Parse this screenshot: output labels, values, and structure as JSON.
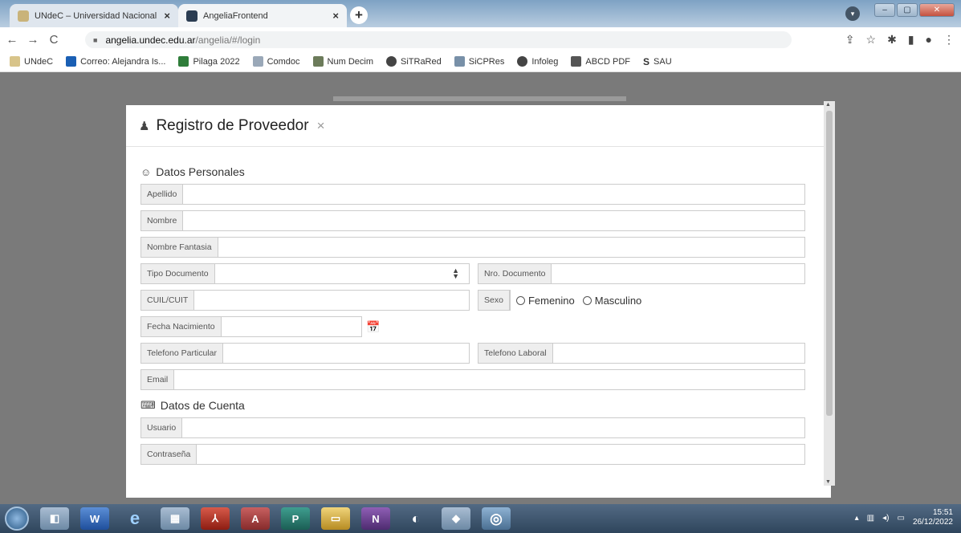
{
  "browser": {
    "tabs": [
      {
        "title": "UNdeC – Universidad Nacional d",
        "active": false
      },
      {
        "title": "AngeliaFrontend",
        "active": true
      }
    ],
    "url_host": "angelia.undec.edu.ar",
    "url_path": "/angelia/#/login",
    "bookmarks": [
      "UNdeC",
      "Correo: Alejandra Is...",
      "Pilaga 2022",
      "Comdoc",
      "Num Decim",
      "SiTRaRed",
      "SiCPRes",
      "Infoleg",
      "ABCD PDF",
      "SAU"
    ]
  },
  "modal": {
    "title": "Registro de Proveedor",
    "close": "×",
    "personal_section": "Datos Personales",
    "fields": {
      "apellido": "Apellido",
      "nombre": "Nombre",
      "nombre_fantasia": "Nombre Fantasia",
      "tipo_documento": "Tipo Documento",
      "nro_documento": "Nro. Documento",
      "cuil_cuit": "CUIL/CUIT",
      "sexo": "Sexo",
      "fecha_nacimiento": "Fecha Nacimiento",
      "telefono_particular": "Telefono Particular",
      "telefono_laboral": "Telefono Laboral",
      "email": "Email"
    },
    "sexo_options": {
      "femenino": "Femenino",
      "masculino": "Masculino"
    },
    "account_section": "Datos de Cuenta",
    "account_fields": {
      "usuario": "Usuario",
      "contrasena": "Contraseña"
    }
  },
  "taskbar": {
    "time": "15:51",
    "date": "26/12/2022"
  }
}
